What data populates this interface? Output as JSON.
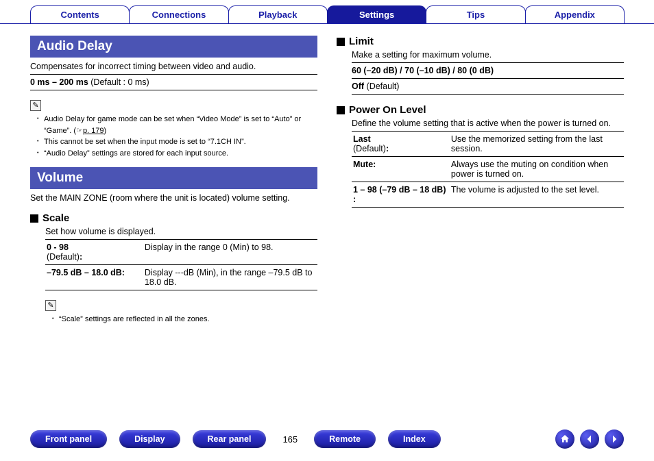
{
  "nav": {
    "tabs": [
      {
        "label": "Contents",
        "active": false
      },
      {
        "label": "Connections",
        "active": false
      },
      {
        "label": "Playback",
        "active": false
      },
      {
        "label": "Settings",
        "active": true
      },
      {
        "label": "Tips",
        "active": false
      },
      {
        "label": "Appendix",
        "active": false
      }
    ]
  },
  "left": {
    "audio_delay": {
      "title": "Audio Delay",
      "desc": "Compensates for incorrect timing between video and audio.",
      "range_bold": "0 ms – 200 ms",
      "range_tail": " (Default : 0 ms)",
      "notes": [
        {
          "pre": "Audio Delay for game mode can be set when “Video Mode” is set to “Auto” or “Game”.  (",
          "page_icon": "☞",
          "page_link": "p. 179",
          "post": ")"
        },
        {
          "pre": "This cannot be set when the input mode is set to “7.1CH IN”.",
          "page_icon": "",
          "page_link": "",
          "post": ""
        },
        {
          "pre": "“Audio Delay” settings are stored for each input source.",
          "page_icon": "",
          "page_link": "",
          "post": ""
        }
      ]
    },
    "volume": {
      "title": "Volume",
      "desc": "Set the MAIN ZONE (room where the unit is located) volume setting."
    },
    "scale": {
      "title": "Scale",
      "desc": "Set how volume is displayed.",
      "rows": [
        {
          "k_bold": "0 - 98",
          "k_sub": "(Default)",
          "k_colon": ":",
          "v": "Display in the range 0 (Min) to 98."
        },
        {
          "k_bold": "–79.5 dB – 18.0 dB:",
          "k_sub": "",
          "k_colon": "",
          "v": "Display ---dB (Min), in the range –79.5 dB to 18.0 dB."
        }
      ],
      "note": "“Scale” settings are reflected in all the zones."
    }
  },
  "right": {
    "limit": {
      "title": "Limit",
      "desc": "Make a setting for maximum volume.",
      "line1": "60 (–20 dB) / 70 (–10 dB) / 80 (0 dB)",
      "line2_bold": "Off",
      "line2_tail": " (Default)"
    },
    "pol": {
      "title": "Power On Level",
      "desc": "Define the volume setting that is active when the power is turned on.",
      "rows": [
        {
          "k_bold": "Last",
          "k_sub": "(Default)",
          "k_colon": ":",
          "v": "Use the memorized setting from the last session."
        },
        {
          "k_bold": "Mute:",
          "k_sub": "",
          "k_colon": "",
          "v": "Always use the muting on condition when power is turned on."
        },
        {
          "k_bold": "1 – 98 (–79 dB – 18 dB) :",
          "k_sub": "",
          "k_colon": "",
          "v": "The volume is adjusted to the set level."
        }
      ]
    }
  },
  "footer": {
    "buttons": [
      "Front panel",
      "Display",
      "Rear panel"
    ],
    "page": "165",
    "buttons2": [
      "Remote",
      "Index"
    ],
    "nav_icons": [
      "home-icon",
      "prev-icon",
      "next-icon"
    ]
  }
}
